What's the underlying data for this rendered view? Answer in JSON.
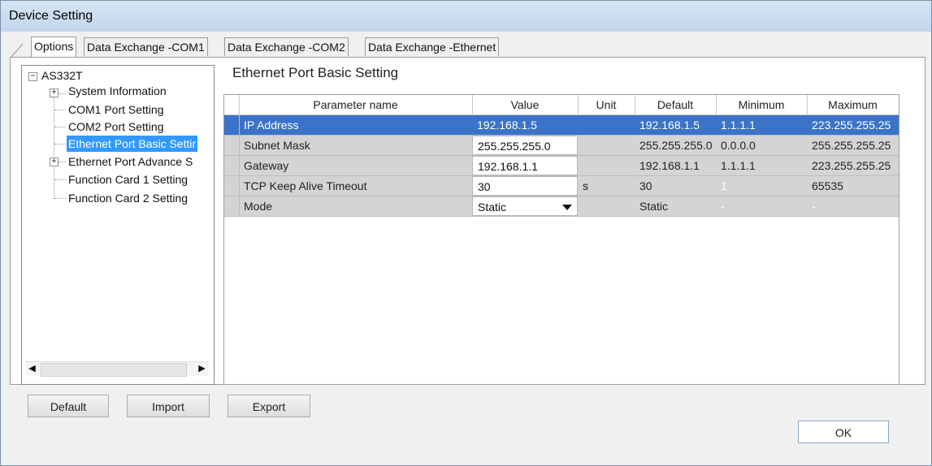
{
  "window": {
    "title": "Device Setting"
  },
  "tabs": [
    {
      "label": "Options",
      "active": true
    },
    {
      "label": "Data Exchange -COM1",
      "active": false
    },
    {
      "label": "Data Exchange -COM2",
      "active": false
    },
    {
      "label": "Data Exchange -Ethernet",
      "active": false
    }
  ],
  "tree": {
    "root": "AS332T",
    "items": [
      {
        "label": "System Information",
        "expandable": true
      },
      {
        "label": "COM1 Port Setting",
        "expandable": false
      },
      {
        "label": "COM2 Port Setting",
        "expandable": false
      },
      {
        "label": "Ethernet Port Basic Settir",
        "expandable": false,
        "selected": true
      },
      {
        "label": "Ethernet Port Advance S",
        "expandable": true
      },
      {
        "label": "Function Card 1 Setting",
        "expandable": false
      },
      {
        "label": "Function Card 2 Setting",
        "expandable": false
      }
    ]
  },
  "panel": {
    "title": "Ethernet Port Basic Setting"
  },
  "grid": {
    "columns": [
      "Parameter name",
      "Value",
      "Unit",
      "Default",
      "Minimum",
      "Maximum"
    ],
    "rows": [
      {
        "name": "IP Address",
        "value": "192.168.1.5",
        "unit": "",
        "default": "192.168.1.5",
        "min": "1.1.1.1",
        "max": "223.255.255.25",
        "selected": true
      },
      {
        "name": "Subnet Mask",
        "value": "255.255.255.0",
        "unit": "",
        "default": "255.255.255.0",
        "min": "0.0.0.0",
        "max": "255.255.255.25"
      },
      {
        "name": "Gateway",
        "value": "192.168.1.1",
        "unit": "",
        "default": "192.168.1.1",
        "min": "1.1.1.1",
        "max": "223.255.255.25"
      },
      {
        "name": "TCP Keep Alive Timeout",
        "value": "30",
        "unit": "s",
        "default": "30",
        "min": "1",
        "max": "65535"
      },
      {
        "name": "Mode",
        "value": "Static",
        "unit": "",
        "default": "Static",
        "min": "-",
        "max": "-"
      }
    ]
  },
  "buttons": {
    "default": "Default",
    "import": "Import",
    "export": "Export",
    "ok": "OK"
  },
  "colors": {
    "selection": "#3b73c8",
    "tree_selection": "#3399ff",
    "row_background": "#d4d4d4"
  }
}
